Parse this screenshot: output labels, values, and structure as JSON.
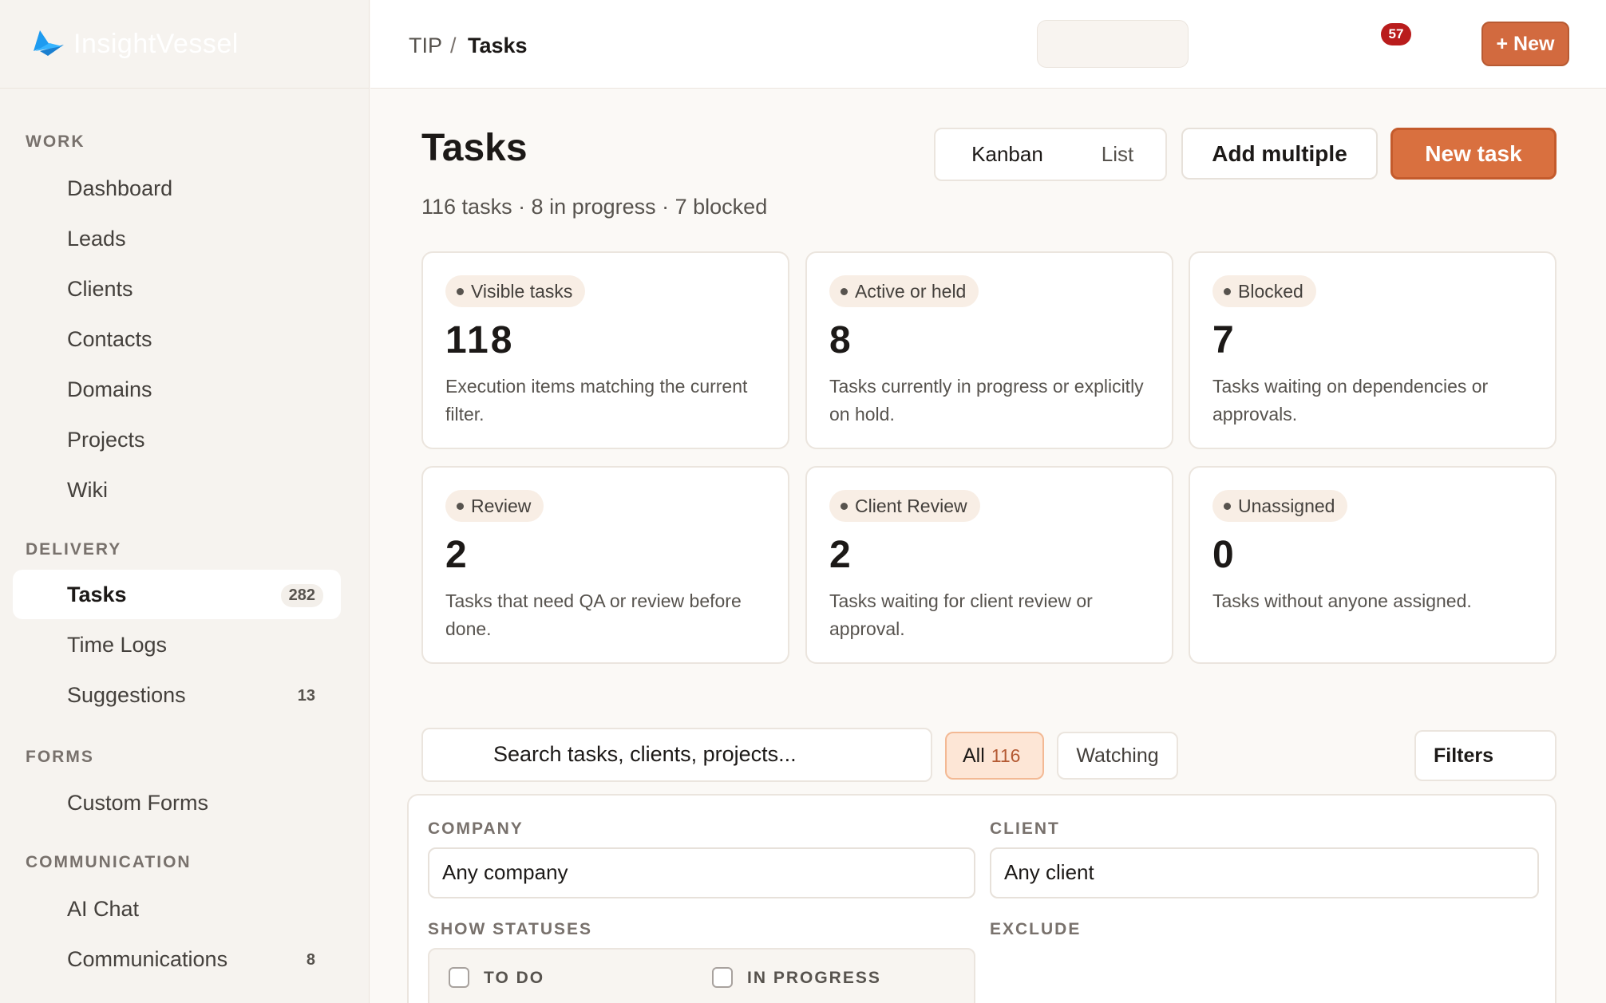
{
  "brand": {
    "name": "InsightVessel"
  },
  "sidebar": {
    "sections": [
      {
        "title": "WORK",
        "items": [
          {
            "label": "Dashboard"
          },
          {
            "label": "Leads"
          },
          {
            "label": "Clients"
          },
          {
            "label": "Contacts"
          },
          {
            "label": "Domains"
          },
          {
            "label": "Projects"
          },
          {
            "label": "Wiki"
          }
        ]
      },
      {
        "title": "DELIVERY",
        "items": [
          {
            "label": "Tasks",
            "count": "282",
            "active": true
          },
          {
            "label": "Time Logs"
          },
          {
            "label": "Suggestions",
            "count": "13"
          }
        ]
      },
      {
        "title": "FORMS",
        "items": [
          {
            "label": "Custom Forms"
          }
        ]
      },
      {
        "title": "COMMUNICATION",
        "items": [
          {
            "label": "AI Chat"
          },
          {
            "label": "Communications",
            "count": "8"
          }
        ]
      }
    ]
  },
  "topbar": {
    "breadcrumb_root": "TIP",
    "breadcrumb_sep": "/",
    "breadcrumb_current": "Tasks",
    "notification_count": "57",
    "new_label": "+ New"
  },
  "page": {
    "title": "Tasks",
    "subtitle": "116 tasks · 8 in progress · 7 blocked",
    "view_kanban": "Kanban",
    "view_list": "List",
    "add_multiple": "Add multiple",
    "new_task": "New task"
  },
  "cards": [
    {
      "label": "Visible tasks",
      "value": "118",
      "desc": "Execution items matching the current filter."
    },
    {
      "label": "Active or held",
      "value": "8",
      "desc": "Tasks currently in progress or explicitly on hold."
    },
    {
      "label": "Blocked",
      "value": "7",
      "desc": "Tasks waiting on dependencies or approvals."
    },
    {
      "label": "Review",
      "value": "2",
      "desc": "Tasks that need QA or review before done."
    },
    {
      "label": "Client Review",
      "value": "2",
      "desc": "Tasks waiting for client review or approval."
    },
    {
      "label": "Unassigned",
      "value": "0",
      "desc": "Tasks without anyone assigned."
    }
  ],
  "filters": {
    "search_text": "Search tasks, clients, projects...",
    "all_label": "All",
    "all_count": "116",
    "watching_label": "Watching",
    "filters_label": "Filters",
    "company_label": "COMPANY",
    "company_value": "Any company",
    "client_label": "CLIENT",
    "client_value": "Any client",
    "statuses_label": "SHOW STATUSES",
    "exclude_label": "EXCLUDE",
    "status_todo": "TO DO",
    "status_inprogress": "IN PROGRESS"
  },
  "colors": {
    "accent": "#d9703f",
    "badge": "#b91c1c"
  }
}
